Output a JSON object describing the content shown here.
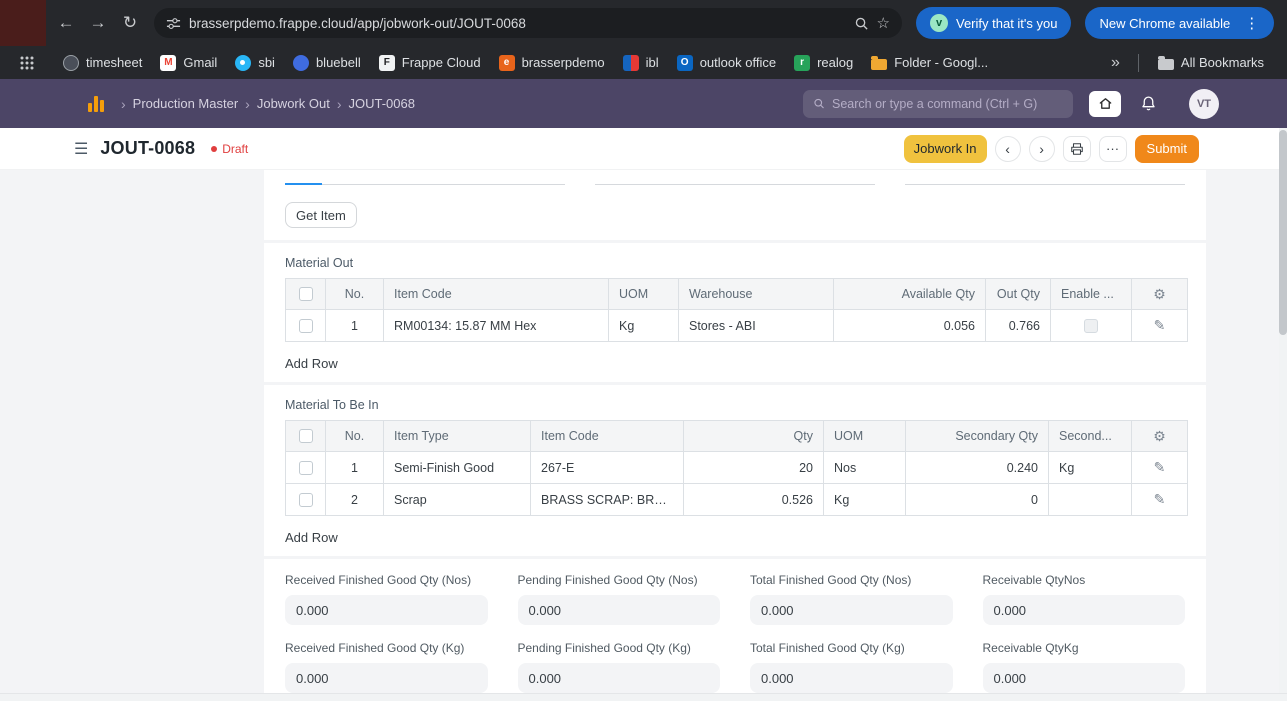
{
  "colors": {
    "navbar": "#4C4566",
    "chrome_dark": "#26282C",
    "accent_blue": "#2490EF",
    "chrome_pill_blue": "#1A66C8",
    "draft_red": "#E03E3E",
    "jobwork_in_button": "#F0C23E",
    "submit_button": "#F0881A",
    "logo_orange": "#F59E0B"
  },
  "browser": {
    "url": "brasserpdemo.frappe.cloud/app/jobwork-out/JOUT-0068",
    "verify_button_label": "Verify that it's you",
    "update_button_label": "New Chrome available",
    "bookmarks": [
      "timesheet",
      "Gmail",
      "sbi",
      "bluebell",
      "Frappe Cloud",
      "brasserpdemo",
      "ibl",
      "outlook office",
      "realog",
      "Folder - Googl..."
    ],
    "bookmarks_overflow_glyph": "»",
    "all_bookmarks_label": "All Bookmarks"
  },
  "navbar": {
    "breadcrumbs": [
      "Production Master",
      "Jobwork Out",
      "JOUT-0068"
    ],
    "search_placeholder": "Search or type a command (Ctrl + G)",
    "avatar_initials": "VT"
  },
  "page": {
    "title": "JOUT-0068",
    "status_label": "Draft",
    "jobwork_in_label": "Jobwork In",
    "submit_label": "Submit",
    "get_item_label": "Get Item"
  },
  "material_out": {
    "section_label": "Material Out",
    "headers": {
      "no": "No.",
      "item_code": "Item Code",
      "uom": "UOM",
      "warehouse": "Warehouse",
      "available_qty": "Available Qty",
      "out_qty": "Out Qty",
      "enable": "Enable ..."
    },
    "rows": [
      {
        "no": "1",
        "item_code": "RM00134: 15.87 MM Hex",
        "uom": "Kg",
        "warehouse": "Stores - ABI",
        "available_qty": "0.056",
        "out_qty": "0.766"
      }
    ],
    "add_row_label": "Add Row"
  },
  "material_to_be_in": {
    "section_label": "Material To Be In",
    "headers": {
      "no": "No.",
      "item_type": "Item Type",
      "item_code": "Item Code",
      "qty": "Qty",
      "uom": "UOM",
      "secondary_qty": "Secondary Qty",
      "secondary": "Second..."
    },
    "rows": [
      {
        "no": "1",
        "item_type": "Semi-Finish Good",
        "item_code": "267-E",
        "qty": "20",
        "uom": "Nos",
        "secondary_qty": "0.240",
        "secondary_uom": "Kg"
      },
      {
        "no": "2",
        "item_type": "Scrap",
        "item_code": "BRASS SCRAP: BRASS ...",
        "qty": "0.526",
        "uom": "Kg",
        "secondary_qty": "0",
        "secondary_uom": ""
      }
    ],
    "add_row_label": "Add Row"
  },
  "summary_fields": [
    {
      "label": "Received Finished Good Qty (Nos)",
      "value": "0.000"
    },
    {
      "label": "Pending Finished Good Qty (Nos)",
      "value": "0.000"
    },
    {
      "label": "Total Finished Good Qty (Nos)",
      "value": "0.000"
    },
    {
      "label": "Receivable QtyNos",
      "value": "0.000"
    },
    {
      "label": "Received Finished Good Qty (Kg)",
      "value": "0.000"
    },
    {
      "label": "Pending Finished Good Qty (Kg)",
      "value": "0.000"
    },
    {
      "label": "Total Finished Good Qty (Kg)",
      "value": "0.000"
    },
    {
      "label": "Receivable QtyKg",
      "value": "0.000"
    }
  ]
}
